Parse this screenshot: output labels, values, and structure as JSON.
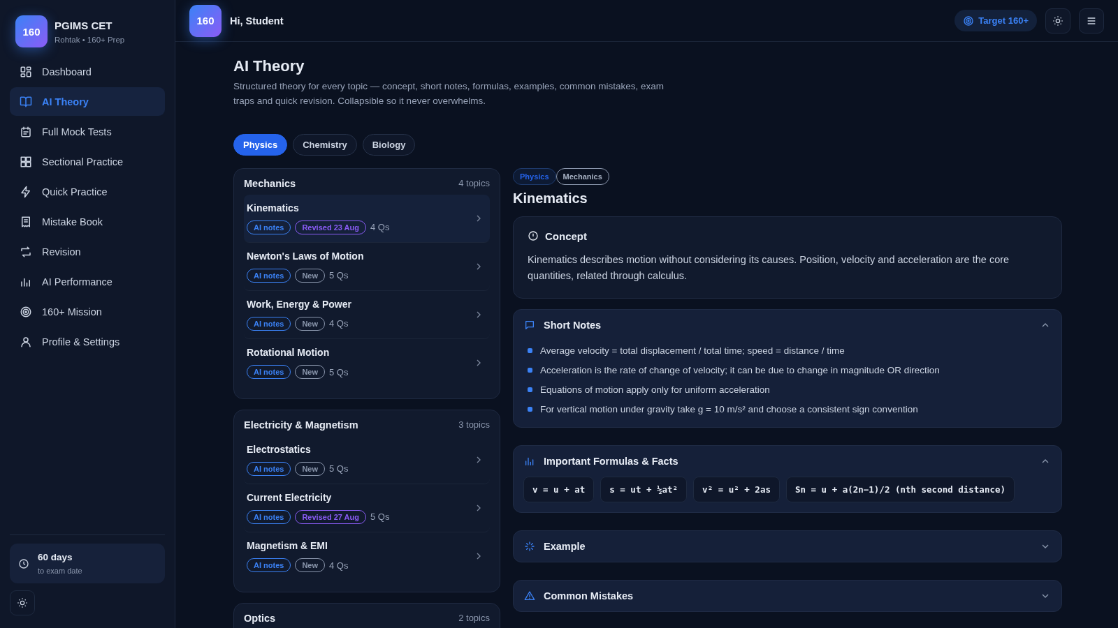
{
  "sidebar": {
    "logo": "160",
    "brand": "PGIMS CET",
    "tagline": "Rohtak • 160+ Prep",
    "items": [
      {
        "label": "Dashboard",
        "selected": false
      },
      {
        "label": "AI Theory",
        "selected": true
      },
      {
        "label": "Full Mock Tests",
        "selected": false
      },
      {
        "label": "Sectional Practice",
        "selected": false
      },
      {
        "label": "Quick Practice",
        "selected": false
      },
      {
        "label": "Mistake Book",
        "selected": false
      },
      {
        "label": "Revision",
        "selected": false
      },
      {
        "label": "AI Performance",
        "selected": false
      },
      {
        "label": "160+ Mission",
        "selected": false
      },
      {
        "label": "Profile & Settings",
        "selected": false
      }
    ],
    "countdown": {
      "days": "60 days",
      "caption": "to exam date"
    }
  },
  "topbar": {
    "logo": "160",
    "greeting": "Hi, Student",
    "target": "Target 160+"
  },
  "page": {
    "title": "AI Theory",
    "subtitle": "Structured theory for every topic — concept, short notes, formulas, examples, common mistakes, exam traps and quick revision. Collapsible so it never overwhelms."
  },
  "subjects": [
    {
      "label": "Physics",
      "selected": true
    },
    {
      "label": "Chemistry",
      "selected": false
    },
    {
      "label": "Biology",
      "selected": false
    }
  ],
  "chapters": [
    {
      "title": "Mechanics",
      "count": "4 topics",
      "topics": [
        {
          "name": "Kinematics",
          "selected": true,
          "tags": [
            {
              "kind": "ai",
              "label": "AI notes"
            },
            {
              "kind": "revised",
              "label": "Revised 23 Aug"
            }
          ],
          "qs": "4 Qs"
        },
        {
          "name": "Newton's Laws of Motion",
          "selected": false,
          "tags": [
            {
              "kind": "ai",
              "label": "AI notes"
            },
            {
              "kind": "new",
              "label": "New"
            }
          ],
          "qs": "5 Qs"
        },
        {
          "name": "Work, Energy & Power",
          "selected": false,
          "tags": [
            {
              "kind": "ai",
              "label": "AI notes"
            },
            {
              "kind": "new",
              "label": "New"
            }
          ],
          "qs": "4 Qs"
        },
        {
          "name": "Rotational Motion",
          "selected": false,
          "tags": [
            {
              "kind": "ai",
              "label": "AI notes"
            },
            {
              "kind": "new",
              "label": "New"
            }
          ],
          "qs": "5 Qs"
        }
      ]
    },
    {
      "title": "Electricity & Magnetism",
      "count": "3 topics",
      "topics": [
        {
          "name": "Electrostatics",
          "selected": false,
          "tags": [
            {
              "kind": "ai",
              "label": "AI notes"
            },
            {
              "kind": "new",
              "label": "New"
            }
          ],
          "qs": "5 Qs"
        },
        {
          "name": "Current Electricity",
          "selected": false,
          "tags": [
            {
              "kind": "ai",
              "label": "AI notes"
            },
            {
              "kind": "revised",
              "label": "Revised 27 Aug"
            }
          ],
          "qs": "5 Qs"
        },
        {
          "name": "Magnetism & EMI",
          "selected": false,
          "tags": [
            {
              "kind": "ai",
              "label": "AI notes"
            },
            {
              "kind": "new",
              "label": "New"
            }
          ],
          "qs": "4 Qs"
        }
      ]
    },
    {
      "title": "Optics",
      "count": "2 topics"
    }
  ],
  "detail": {
    "breadcrumb": [
      {
        "kind": "subject",
        "label": "Physics"
      },
      {
        "kind": "chapter",
        "label": "Mechanics"
      }
    ],
    "title": "Kinematics",
    "concept": {
      "title": "Concept",
      "text": "Kinematics describes motion without considering its causes. Position, velocity and acceleration are the core quantities, related through calculus."
    },
    "sections": [
      {
        "kind": "notes",
        "title": "Short Notes",
        "expanded": true,
        "items": [
          "Average velocity = total displacement / total time; speed = distance / time",
          "Acceleration is the rate of change of velocity; it can be due to change in magnitude OR direction",
          "Equations of motion apply only for uniform acceleration",
          "For vertical motion under gravity take g = 10 m/s² and choose a consistent sign convention"
        ]
      },
      {
        "kind": "formulas",
        "title": "Important Formulas & Facts",
        "expanded": true,
        "items": [
          "v = u + at",
          "s = ut + ½at²",
          "v² = u² + 2as",
          "Sn = u + a(2n−1)/2 (nth second distance)"
        ]
      },
      {
        "kind": "example",
        "title": "Example",
        "expanded": false
      },
      {
        "kind": "mistakes",
        "title": "Common Mistakes",
        "expanded": false
      }
    ]
  }
}
